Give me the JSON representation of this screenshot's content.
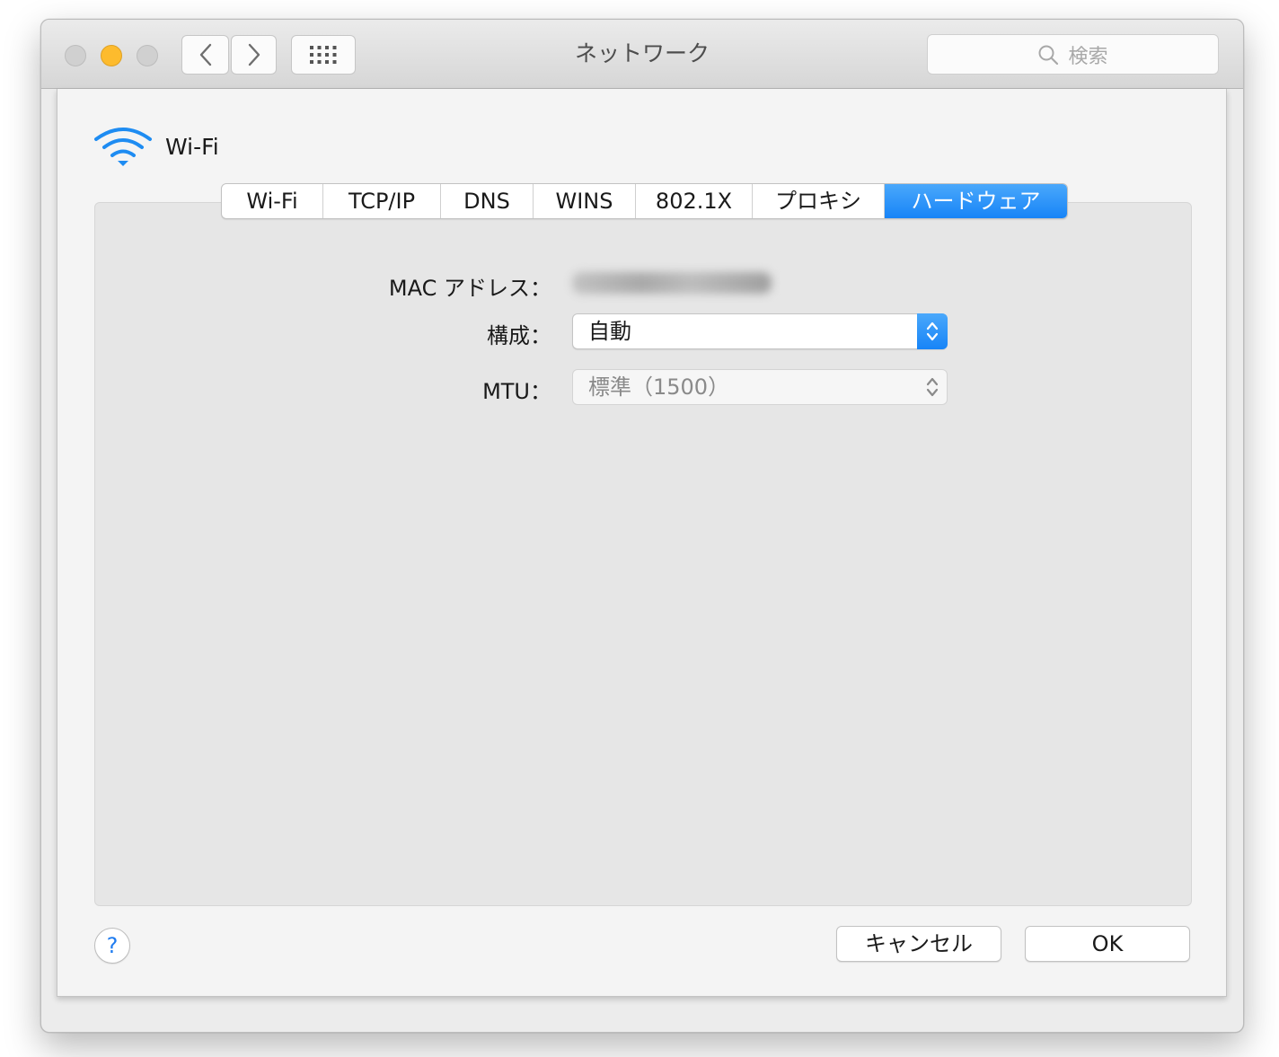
{
  "window": {
    "title": "ネットワーク",
    "search_placeholder": "検索",
    "icons": {
      "back": "chevron-left-icon",
      "forward": "chevron-right-icon",
      "grid": "grid-icon",
      "search": "search-icon"
    }
  },
  "header": {
    "service_name": "Wi-Fi",
    "icon": "wifi-icon"
  },
  "tabs": [
    {
      "label": "Wi-Fi",
      "active": false
    },
    {
      "label": "TCP/IP",
      "active": false
    },
    {
      "label": "DNS",
      "active": false
    },
    {
      "label": "WINS",
      "active": false
    },
    {
      "label": "802.1X",
      "active": false
    },
    {
      "label": "プロキシ",
      "active": false
    },
    {
      "label": "ハードウェア",
      "active": true
    }
  ],
  "hardware": {
    "mac_label": "MAC アドレス：",
    "config_label": "構成：",
    "config_value": "自動",
    "mtu_label": "MTU：",
    "mtu_value": "標準（1500）"
  },
  "footer": {
    "help_label": "?",
    "cancel_label": "キャンセル",
    "ok_label": "OK"
  },
  "colors": {
    "accent": "#1784f7",
    "traffic_minimize": "#fdbb2d"
  }
}
